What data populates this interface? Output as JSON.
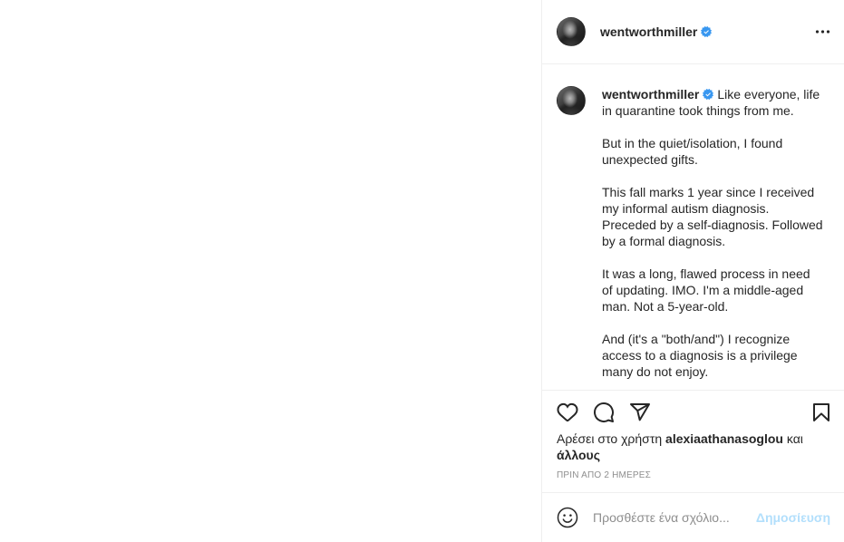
{
  "post": {
    "author": {
      "username": "wentworthmiller",
      "verified": true
    },
    "caption": {
      "username": "wentworthmiller",
      "paragraphs": [
        [
          "Like everyone, life",
          "in quarantine took things from me."
        ],
        [
          "But in the quiet/isolation, I found",
          "unexpected gifts."
        ],
        [
          "This fall marks 1 year since I received",
          "my informal autism diagnosis.",
          "Preceded by a self-diagnosis. Followed",
          "by a formal diagnosis."
        ],
        [
          "It was a long, flawed process in need",
          "of updating. IMO. I'm a middle-aged",
          "man. Not a 5-year-old."
        ],
        [
          "And (it's a \"both/and\") I recognize",
          "access to a diagnosis is a privilege",
          "many do not enjoy."
        ]
      ]
    },
    "likes": {
      "prefix": "Αρέσει στο χρήστη",
      "user": "alexiaathanasoglou",
      "conjunction": "και",
      "others": "άλλους"
    },
    "timestamp": "ΠΡΙΝ ΑΠΟ 2 ΗΜΕΡΕΣ",
    "comment_box": {
      "placeholder": "Προσθέστε ένα σχόλιο...",
      "value": "",
      "post_label": "Δημοσίευση",
      "post_enabled": false
    }
  },
  "icons": {
    "more": "more-horizontal-icon",
    "verified": "verified-badge-icon",
    "like": "heart-icon",
    "comment": "comment-icon",
    "share": "share-icon",
    "save": "bookmark-icon",
    "emoji": "emoji-icon"
  },
  "colors": {
    "text": "#262626",
    "muted": "#8e8e8e",
    "verified": "#3897f0",
    "border": "#efefef",
    "post": "#b2dffc"
  }
}
